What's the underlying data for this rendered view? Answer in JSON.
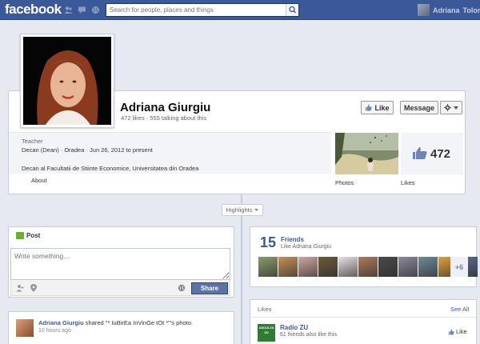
{
  "topbar": {
    "logo": "facebook",
    "search_placeholder": "Search for people, places and things",
    "user_name": "Adriana",
    "user_name_suffix": "Tolom"
  },
  "profile": {
    "name": "Adriana Giurgiu",
    "stats": "472 likes · 555 talking about this",
    "like_button": "Like",
    "message_button": "Message",
    "category": "Teacher",
    "job_line": "Decan (Dean) · Oradea · Jun 26, 2012 to present",
    "job_detail": "Decan al Facultatii de Stiinte Economice, Universitatea din Oradea",
    "about_label": "About",
    "photos_label": "Photos",
    "likes_count": "472",
    "likes_label": "Likes"
  },
  "highlights": {
    "label": "Highlights"
  },
  "composer": {
    "tab_label": "Post",
    "placeholder": "Write something...",
    "share_button": "Share"
  },
  "friends": {
    "count": "15",
    "title": "Friends",
    "subtitle": "Like Adriana Giurgiu",
    "more": "+6",
    "thumb_colors": [
      "#8a9b6b",
      "#c98f5a",
      "#d1a6a0",
      "#6b5a3a",
      "#e8e0e0",
      "#b07a5a",
      "#4a4a4a",
      "#8a8a9b",
      "#6e8a9a",
      "#e0a040",
      "#5a6e8a"
    ]
  },
  "activity": {
    "author": "Adriana Giurgiu",
    "text": "shared \"* IuBirEa InVinGe tOt *\"'s photo.",
    "time": "10 hours ago"
  },
  "likes_section": {
    "title": "Likes",
    "see_all": "See All",
    "page_name": "Radio ZU",
    "page_sub": "61 friends also like this.",
    "like_label": "Like",
    "page_logo_text": "ASCULTA ZU"
  },
  "colors": {
    "brand": "#3b5998",
    "background": "#e6e9f0",
    "share_button": "#5b74a8"
  }
}
